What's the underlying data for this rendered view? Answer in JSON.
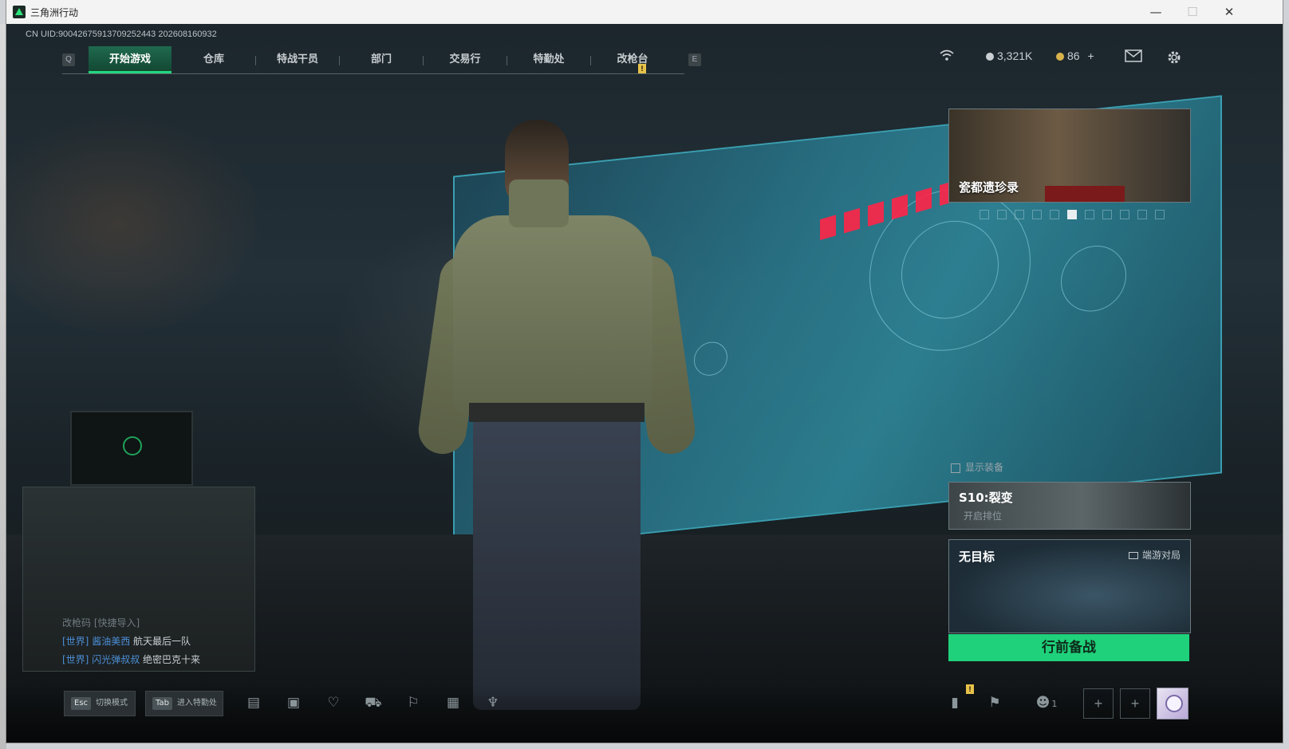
{
  "window": {
    "title": "三角洲行动",
    "minimize": "—",
    "maximize": "☐",
    "close": "✕"
  },
  "uid_text": "CN UID:900426759137092524​43 202608160932",
  "nav": {
    "left_key": "Q",
    "right_key": "E",
    "notice": "!",
    "tabs": [
      {
        "label": "开始游戏",
        "active": true
      },
      {
        "label": "仓库",
        "active": false
      },
      {
        "label": "特战干员",
        "active": false
      },
      {
        "label": "部门",
        "active": false
      },
      {
        "label": "交易行",
        "active": false
      },
      {
        "label": "特勤处",
        "active": false
      },
      {
        "label": "改枪台",
        "active": false
      }
    ]
  },
  "currency": {
    "silver": "3,321K",
    "gold": "86",
    "gold_add": "+",
    "silver_color": "#c9cfd3",
    "gold_color": "#d9b24c"
  },
  "icons": {
    "wifi": "wifi-icon",
    "mail": "mail-icon",
    "settings": "gear-icon"
  },
  "banner": {
    "title": "瓷都遗珍录",
    "dots_total": 11,
    "dot_active": 5
  },
  "equip_toggle": "显示装备",
  "season": {
    "title": "S10:裂变",
    "subtitle": "开启排位"
  },
  "mode": {
    "title": "无目标",
    "right_label": "端游对局"
  },
  "go_button": "行前备战",
  "chat": {
    "top": {
      "a": "改枪码",
      "b": "[快捷导入]"
    },
    "lines": [
      {
        "channel": "[世界]",
        "name": "酱油美西",
        "text": "航天最后一队"
      },
      {
        "channel": "[世界]",
        "name": "闪光弹叔叔",
        "text": "绝密巴克十来"
      }
    ]
  },
  "bottom": {
    "esc": {
      "key": "Esc",
      "label": "切换模式"
    },
    "tab": {
      "key": "Tab",
      "label": "进入特勤处"
    },
    "friends_count": "1",
    "notice": "!"
  },
  "colors": {
    "accent_green": "#1fd17a",
    "nav_active": "#1f6a4f",
    "hazard_red": "#ff2447",
    "screen_cyan": "#2f8da0"
  }
}
